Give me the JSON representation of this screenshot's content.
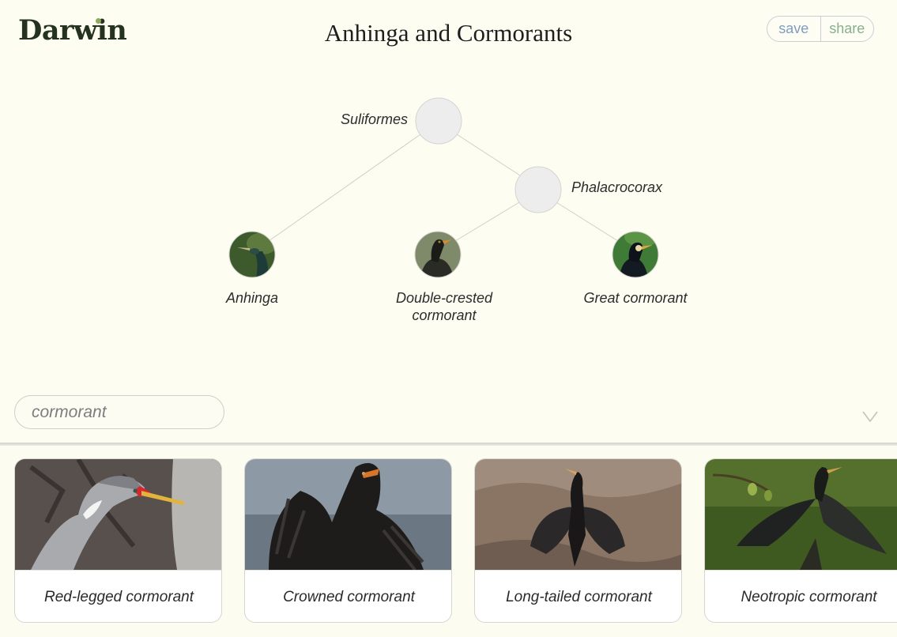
{
  "app": {
    "name": "Darwin",
    "title": "Anhinga and Cormorants"
  },
  "toolbar": {
    "save_label": "save",
    "share_label": "share"
  },
  "tree": {
    "root_label": "Suliformes",
    "inner_label": "Phalacrocorax",
    "leaves": [
      {
        "label": "Anhinga"
      },
      {
        "label": "Double-crested cormorant"
      },
      {
        "label": "Great cormorant"
      }
    ]
  },
  "search": {
    "value": "cormorant"
  },
  "results": [
    {
      "label": "Red-legged cormorant"
    },
    {
      "label": "Crowned cormorant"
    },
    {
      "label": "Long-tailed cormorant"
    },
    {
      "label": "Neotropic cormorant"
    }
  ],
  "colors": {
    "background": "#fefdf1",
    "logo": "#253220",
    "save": "#7e9dc1",
    "share": "#86b08d"
  }
}
